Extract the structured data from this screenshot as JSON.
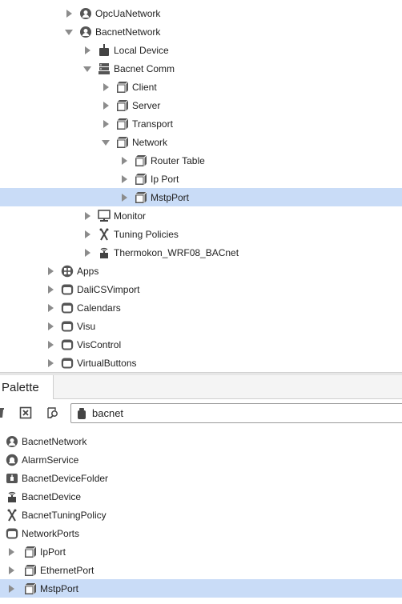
{
  "colors": {
    "selection": "#c9dcf7",
    "icon": "#555555"
  },
  "tree": {
    "items": [
      {
        "label": "OpcUaNetwork",
        "icon": "network-icon",
        "state": "collapsed",
        "depth": 4
      },
      {
        "label": "BacnetNetwork",
        "icon": "network-icon",
        "state": "expanded",
        "depth": 4
      },
      {
        "label": "Local Device",
        "icon": "device-icon",
        "state": "collapsed",
        "depth": 5
      },
      {
        "label": "Bacnet Comm",
        "icon": "server-icon",
        "state": "expanded",
        "depth": 5
      },
      {
        "label": "Client",
        "icon": "cube-icon",
        "state": "collapsed",
        "depth": 6
      },
      {
        "label": "Server",
        "icon": "cube-icon",
        "state": "collapsed",
        "depth": 6
      },
      {
        "label": "Transport",
        "icon": "cube-icon",
        "state": "collapsed",
        "depth": 6
      },
      {
        "label": "Network",
        "icon": "cube-icon",
        "state": "expanded",
        "depth": 6
      },
      {
        "label": "Router Table",
        "icon": "cube-icon",
        "state": "collapsed",
        "depth": 7
      },
      {
        "label": "Ip Port",
        "icon": "cube-icon",
        "state": "collapsed",
        "depth": 7
      },
      {
        "label": "MstpPort",
        "icon": "cube-icon",
        "state": "collapsed",
        "depth": 7,
        "selected": true
      },
      {
        "label": "Monitor",
        "icon": "monitor-icon",
        "state": "collapsed",
        "depth": 5
      },
      {
        "label": "Tuning Policies",
        "icon": "tuning-icon",
        "state": "collapsed",
        "depth": 5
      },
      {
        "label": "Thermokon_WRF08_BACnet",
        "icon": "bacnet-device-icon",
        "state": "collapsed",
        "depth": 5
      },
      {
        "label": "Apps",
        "icon": "apps-icon",
        "state": "collapsed",
        "depth": 3
      },
      {
        "label": "DaliCSVimport",
        "icon": "folder-icon",
        "state": "collapsed",
        "depth": 3
      },
      {
        "label": "Calendars",
        "icon": "folder-icon",
        "state": "collapsed",
        "depth": 3
      },
      {
        "label": "Visu",
        "icon": "folder-icon",
        "state": "collapsed",
        "depth": 3
      },
      {
        "label": "VisControl",
        "icon": "folder-icon",
        "state": "collapsed",
        "depth": 3
      },
      {
        "label": "VirtualButtons",
        "icon": "folder-icon",
        "state": "collapsed",
        "depth": 3
      }
    ]
  },
  "palette": {
    "tab_label": "Palette",
    "toolbar": {
      "left_icon": "delete-icon",
      "close_icon": "close-box-icon",
      "find_icon": "find-icon"
    },
    "search": {
      "icon": "jar-icon",
      "value": "bacnet"
    },
    "items": [
      {
        "label": "BacnetNetwork",
        "icon": "network-icon",
        "arrow": false
      },
      {
        "label": "AlarmService",
        "icon": "bell-icon",
        "arrow": false
      },
      {
        "label": "BacnetDeviceFolder",
        "icon": "device-folder-icon",
        "arrow": false
      },
      {
        "label": "BacnetDevice",
        "icon": "bacnet-device-icon",
        "arrow": false
      },
      {
        "label": "BacnetTuningPolicy",
        "icon": "tuning-icon",
        "arrow": false
      },
      {
        "label": "NetworkPorts",
        "icon": "folder-icon",
        "arrow": false
      },
      {
        "label": "IpPort",
        "icon": "cube-icon",
        "arrow": true
      },
      {
        "label": "EthernetPort",
        "icon": "cube-icon",
        "arrow": true
      },
      {
        "label": "MstpPort",
        "icon": "cube-icon",
        "arrow": true,
        "selected": true
      }
    ]
  }
}
